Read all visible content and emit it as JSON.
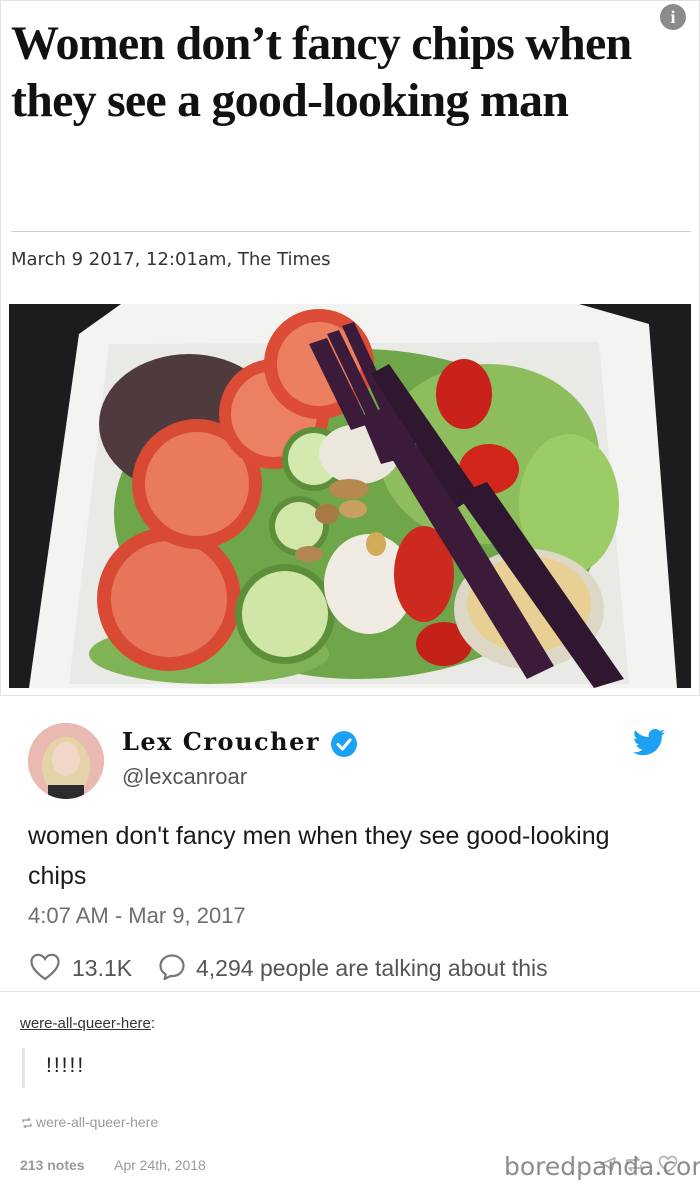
{
  "article": {
    "headline": "Women don’t fancy chips when they see a good-looking man",
    "info_icon": "i",
    "byline": "March 9 2017, 12:01am, The Times"
  },
  "tweet": {
    "display_name": "Lex Croucher",
    "handle": "@lexcanroar",
    "text": "women don't fancy men when they see good-looking chips",
    "timestamp": "4:07 AM - Mar 9, 2017",
    "likes": "13.1K",
    "talking": "4,294 people are talking about this",
    "brand_color": "#1da1f2"
  },
  "tumblr": {
    "reblogger": "were-all-queer-here",
    "reblogger_suffix": ":",
    "quote": "!!!!!",
    "source": "were-all-queer-here",
    "notes": "213 notes",
    "date": "Apr 24th, 2018"
  },
  "watermark": "boredpanda.com",
  "icons": [
    "info-icon",
    "verified-icon",
    "twitter-bird-icon",
    "heart-icon",
    "reply-bubble-icon",
    "reblog-icon",
    "share-icon",
    "heart-outline-icon"
  ]
}
